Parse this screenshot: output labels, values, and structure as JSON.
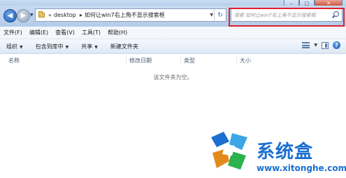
{
  "window": {
    "minimize_glyph": "–",
    "maximize_glyph": "□",
    "close_glyph": "✕"
  },
  "address_bar": {
    "overflow": "«",
    "crumbs": [
      "desktop",
      "如何让win7右上角不显示搜索框"
    ],
    "separator": "▸",
    "dropdown_glyph": "▼",
    "refresh_glyph": "↻"
  },
  "search": {
    "placeholder": "搜索 如何让win7右上角不显示搜索框"
  },
  "menubar": [
    "文件(F)",
    "编辑(E)",
    "查看(V)",
    "工具(T)",
    "帮助(H)"
  ],
  "commandbar": {
    "organize": "组织",
    "include_library": "包含到库中",
    "share": "共享",
    "new_folder": "新建文件夹",
    "arrow": "▼",
    "help_glyph": "?"
  },
  "columns": [
    "名称",
    "修改日期",
    "类型",
    "大小"
  ],
  "empty_message": "该文件夹为空。",
  "watermark": {
    "brand": "系统盒",
    "url": "www.xitonghe.com"
  },
  "colors": {
    "highlight": "#e0202b",
    "watermark": "#1a6fd1"
  }
}
